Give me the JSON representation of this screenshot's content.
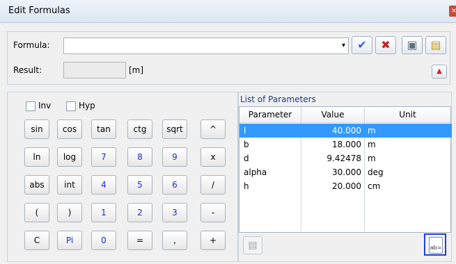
{
  "window": {
    "title": "Edit Formulas",
    "close_glyph": "×"
  },
  "formula": {
    "label": "Formula:",
    "value": "",
    "dropdown_glyph": "▾"
  },
  "toolbar": {
    "ok_glyph": "✔",
    "cancel_glyph": "✖",
    "save_glyph": "▣",
    "open_glyph": "▤"
  },
  "result": {
    "label": "Result:",
    "value": "",
    "unit": "[m]",
    "warn_glyph": "▲"
  },
  "options": {
    "inv_label": "Inv",
    "hyp_label": "Hyp"
  },
  "keypad": {
    "rows": [
      [
        "sin",
        "cos",
        "tan",
        "ctg",
        "sqrt",
        "^"
      ],
      [
        "ln",
        "log",
        "7",
        "8",
        "9",
        "x"
      ],
      [
        "abs",
        "int",
        "4",
        "5",
        "6",
        "/"
      ],
      [
        "(",
        ")",
        "1",
        "2",
        "3",
        "-"
      ],
      [
        "C",
        "Pi",
        "0",
        "=",
        ",",
        "+"
      ]
    ]
  },
  "parameters": {
    "title": "List of Parameters",
    "columns": [
      "Parameter",
      "Value",
      "Unit"
    ],
    "rows": [
      {
        "name": "l",
        "value": "40.000",
        "unit": "m"
      },
      {
        "name": "b",
        "value": "18.000",
        "unit": "m"
      },
      {
        "name": "d",
        "value": "9.42478",
        "unit": "m"
      },
      {
        "name": "alpha",
        "value": "30.000",
        "unit": "deg"
      },
      {
        "name": "h",
        "value": "20.000",
        "unit": "cm"
      }
    ],
    "selected_row": 0,
    "left_tool_glyph": "▤",
    "right_tool_label": "ab="
  },
  "colors": {
    "accent": "#3399ff",
    "digit_blue": "#1a2ed0",
    "highlight_border": "#1f3fd6"
  }
}
